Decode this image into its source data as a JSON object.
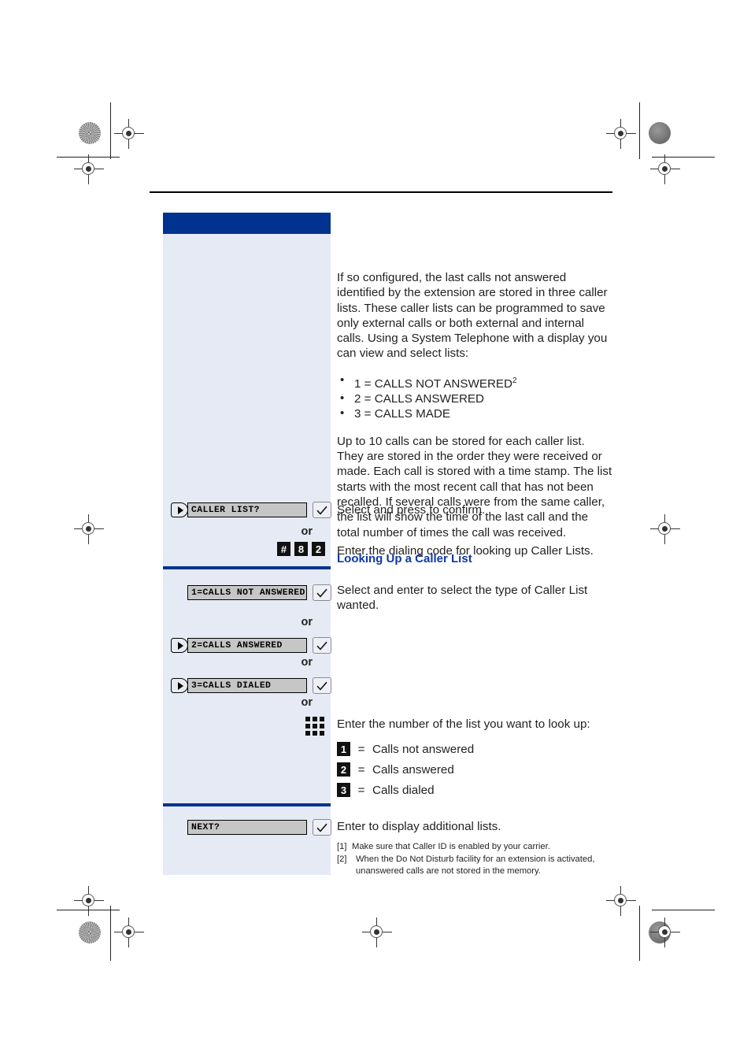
{
  "document": {
    "intro_paragraph": "If so configured, the last calls not answered identified by the extension are stored in three caller lists. These caller lists can be programmed to save only external calls or both external and internal calls. Using a System Telephone with a display you can view and select lists:",
    "bullets": [
      {
        "text": "1 = CALLS NOT ANSWERED",
        "footnote": "2"
      },
      {
        "text": "2 = CALLS ANSWERED",
        "footnote": ""
      },
      {
        "text": "3 = CALLS MADE",
        "footnote": ""
      }
    ],
    "second_paragraph": "Up to 10 calls can be stored for each caller list. They are stored in the order they were received or made. Each call is stored with a time stamp. The list starts with the most recent call that has not been recalled. If several calls were from the same caller, the list will show the time of the last call and the total number of times the call was received.",
    "section_heading": "Looking Up a Caller List",
    "or_label": "or"
  },
  "steps": {
    "caller_list": {
      "display_text": "CALLER LIST?",
      "instruction": "Select and press to confirm."
    },
    "dial_code": {
      "keys": [
        "#",
        "8",
        "2"
      ],
      "instruction": "Enter the dialing code for looking up Caller Lists."
    },
    "list_types": {
      "instruction": "Select and enter to select the type of Caller List wanted.",
      "options": [
        {
          "display_text": "1=CALLS NOT ANSWERED",
          "has_arrow": false
        },
        {
          "display_text": "2=CALLS ANSWERED",
          "has_arrow": true
        },
        {
          "display_text": "3=CALLS DIALED",
          "has_arrow": true
        }
      ]
    },
    "keypad_entry": {
      "instruction": "Enter the number of the list you want to look up:",
      "legend": [
        {
          "key": "1",
          "equals": "=",
          "label": "Calls not answered"
        },
        {
          "key": "2",
          "equals": "=",
          "label": "Calls answered"
        },
        {
          "key": "3",
          "equals": "=",
          "label": "Calls dialed"
        }
      ]
    },
    "next": {
      "display_text": "NEXT?",
      "instruction": "Enter to display additional lists."
    }
  },
  "footnotes": [
    {
      "marker": "[1]",
      "text": "Make sure that Caller ID is enabled by your carrier."
    },
    {
      "marker": "[2]",
      "text": "When the Do Not Disturb facility for an extension is activated, unanswered calls are not stored in the memory."
    }
  ],
  "colors": {
    "accent_blue": "#00338f",
    "heading_blue": "#0d38a4",
    "sidebar_bg": "#e6eaf4",
    "display_bg": "#c6c6c6"
  }
}
